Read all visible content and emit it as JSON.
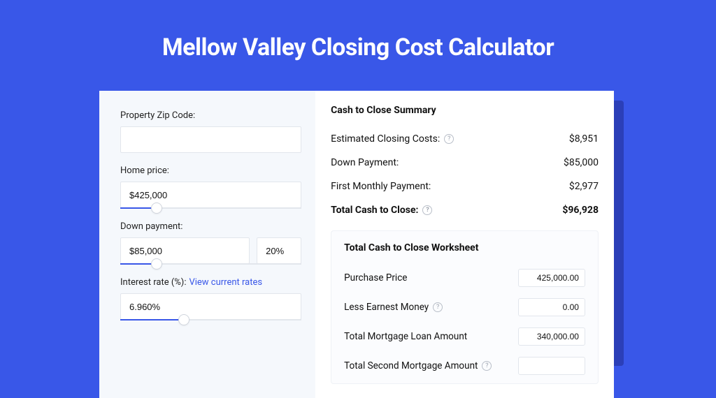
{
  "title": "Mellow Valley Closing Cost Calculator",
  "form": {
    "zip": {
      "label": "Property Zip Code:",
      "value": ""
    },
    "home_price": {
      "label": "Home price:",
      "value": "$425,000",
      "slider_pct": 20
    },
    "down_payment": {
      "label": "Down payment:",
      "value": "$85,000",
      "pct": "20%",
      "slider_pct": 20
    },
    "interest": {
      "label": "Interest rate (%):",
      "link_text": "View current rates",
      "value": "6.960%",
      "slider_pct": 35
    }
  },
  "summary": {
    "title": "Cash to Close Summary",
    "rows": [
      {
        "label": "Estimated Closing Costs:",
        "help": true,
        "value": "$8,951",
        "bold": false
      },
      {
        "label": "Down Payment:",
        "help": false,
        "value": "$85,000",
        "bold": false
      },
      {
        "label": "First Monthly Payment:",
        "help": false,
        "value": "$2,977",
        "bold": false
      },
      {
        "label": "Total Cash to Close:",
        "help": true,
        "value": "$96,928",
        "bold": true
      }
    ]
  },
  "worksheet": {
    "title": "Total Cash to Close Worksheet",
    "rows": [
      {
        "label": "Purchase Price",
        "help": false,
        "value": "425,000.00"
      },
      {
        "label": "Less Earnest Money",
        "help": true,
        "value": "0.00"
      },
      {
        "label": "Total Mortgage Loan Amount",
        "help": false,
        "value": "340,000.00"
      },
      {
        "label": "Total Second Mortgage Amount",
        "help": true,
        "value": ""
      }
    ]
  }
}
